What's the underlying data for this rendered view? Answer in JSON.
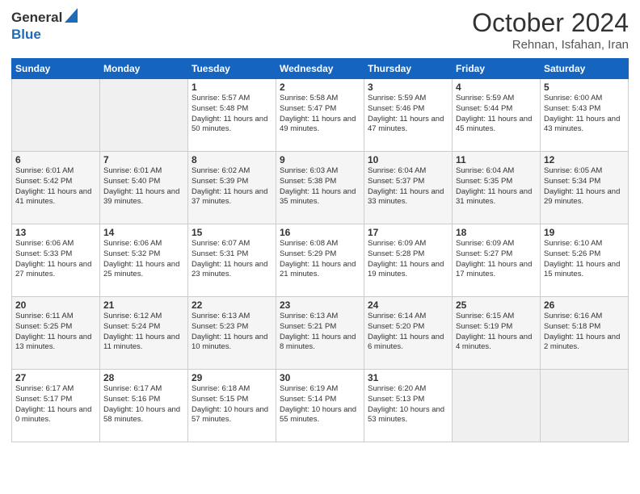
{
  "header": {
    "logo_general": "General",
    "logo_blue": "Blue",
    "month_year": "October 2024",
    "location": "Rehnan, Isfahan, Iran"
  },
  "days_of_week": [
    "Sunday",
    "Monday",
    "Tuesday",
    "Wednesday",
    "Thursday",
    "Friday",
    "Saturday"
  ],
  "weeks": [
    [
      {
        "day": "",
        "info": ""
      },
      {
        "day": "",
        "info": ""
      },
      {
        "day": "1",
        "info": "Sunrise: 5:57 AM\nSunset: 5:48 PM\nDaylight: 11 hours and 50 minutes."
      },
      {
        "day": "2",
        "info": "Sunrise: 5:58 AM\nSunset: 5:47 PM\nDaylight: 11 hours and 49 minutes."
      },
      {
        "day": "3",
        "info": "Sunrise: 5:59 AM\nSunset: 5:46 PM\nDaylight: 11 hours and 47 minutes."
      },
      {
        "day": "4",
        "info": "Sunrise: 5:59 AM\nSunset: 5:44 PM\nDaylight: 11 hours and 45 minutes."
      },
      {
        "day": "5",
        "info": "Sunrise: 6:00 AM\nSunset: 5:43 PM\nDaylight: 11 hours and 43 minutes."
      }
    ],
    [
      {
        "day": "6",
        "info": "Sunrise: 6:01 AM\nSunset: 5:42 PM\nDaylight: 11 hours and 41 minutes."
      },
      {
        "day": "7",
        "info": "Sunrise: 6:01 AM\nSunset: 5:40 PM\nDaylight: 11 hours and 39 minutes."
      },
      {
        "day": "8",
        "info": "Sunrise: 6:02 AM\nSunset: 5:39 PM\nDaylight: 11 hours and 37 minutes."
      },
      {
        "day": "9",
        "info": "Sunrise: 6:03 AM\nSunset: 5:38 PM\nDaylight: 11 hours and 35 minutes."
      },
      {
        "day": "10",
        "info": "Sunrise: 6:04 AM\nSunset: 5:37 PM\nDaylight: 11 hours and 33 minutes."
      },
      {
        "day": "11",
        "info": "Sunrise: 6:04 AM\nSunset: 5:35 PM\nDaylight: 11 hours and 31 minutes."
      },
      {
        "day": "12",
        "info": "Sunrise: 6:05 AM\nSunset: 5:34 PM\nDaylight: 11 hours and 29 minutes."
      }
    ],
    [
      {
        "day": "13",
        "info": "Sunrise: 6:06 AM\nSunset: 5:33 PM\nDaylight: 11 hours and 27 minutes."
      },
      {
        "day": "14",
        "info": "Sunrise: 6:06 AM\nSunset: 5:32 PM\nDaylight: 11 hours and 25 minutes."
      },
      {
        "day": "15",
        "info": "Sunrise: 6:07 AM\nSunset: 5:31 PM\nDaylight: 11 hours and 23 minutes."
      },
      {
        "day": "16",
        "info": "Sunrise: 6:08 AM\nSunset: 5:29 PM\nDaylight: 11 hours and 21 minutes."
      },
      {
        "day": "17",
        "info": "Sunrise: 6:09 AM\nSunset: 5:28 PM\nDaylight: 11 hours and 19 minutes."
      },
      {
        "day": "18",
        "info": "Sunrise: 6:09 AM\nSunset: 5:27 PM\nDaylight: 11 hours and 17 minutes."
      },
      {
        "day": "19",
        "info": "Sunrise: 6:10 AM\nSunset: 5:26 PM\nDaylight: 11 hours and 15 minutes."
      }
    ],
    [
      {
        "day": "20",
        "info": "Sunrise: 6:11 AM\nSunset: 5:25 PM\nDaylight: 11 hours and 13 minutes."
      },
      {
        "day": "21",
        "info": "Sunrise: 6:12 AM\nSunset: 5:24 PM\nDaylight: 11 hours and 11 minutes."
      },
      {
        "day": "22",
        "info": "Sunrise: 6:13 AM\nSunset: 5:23 PM\nDaylight: 11 hours and 10 minutes."
      },
      {
        "day": "23",
        "info": "Sunrise: 6:13 AM\nSunset: 5:21 PM\nDaylight: 11 hours and 8 minutes."
      },
      {
        "day": "24",
        "info": "Sunrise: 6:14 AM\nSunset: 5:20 PM\nDaylight: 11 hours and 6 minutes."
      },
      {
        "day": "25",
        "info": "Sunrise: 6:15 AM\nSunset: 5:19 PM\nDaylight: 11 hours and 4 minutes."
      },
      {
        "day": "26",
        "info": "Sunrise: 6:16 AM\nSunset: 5:18 PM\nDaylight: 11 hours and 2 minutes."
      }
    ],
    [
      {
        "day": "27",
        "info": "Sunrise: 6:17 AM\nSunset: 5:17 PM\nDaylight: 11 hours and 0 minutes."
      },
      {
        "day": "28",
        "info": "Sunrise: 6:17 AM\nSunset: 5:16 PM\nDaylight: 10 hours and 58 minutes."
      },
      {
        "day": "29",
        "info": "Sunrise: 6:18 AM\nSunset: 5:15 PM\nDaylight: 10 hours and 57 minutes."
      },
      {
        "day": "30",
        "info": "Sunrise: 6:19 AM\nSunset: 5:14 PM\nDaylight: 10 hours and 55 minutes."
      },
      {
        "day": "31",
        "info": "Sunrise: 6:20 AM\nSunset: 5:13 PM\nDaylight: 10 hours and 53 minutes."
      },
      {
        "day": "",
        "info": ""
      },
      {
        "day": "",
        "info": ""
      }
    ]
  ]
}
